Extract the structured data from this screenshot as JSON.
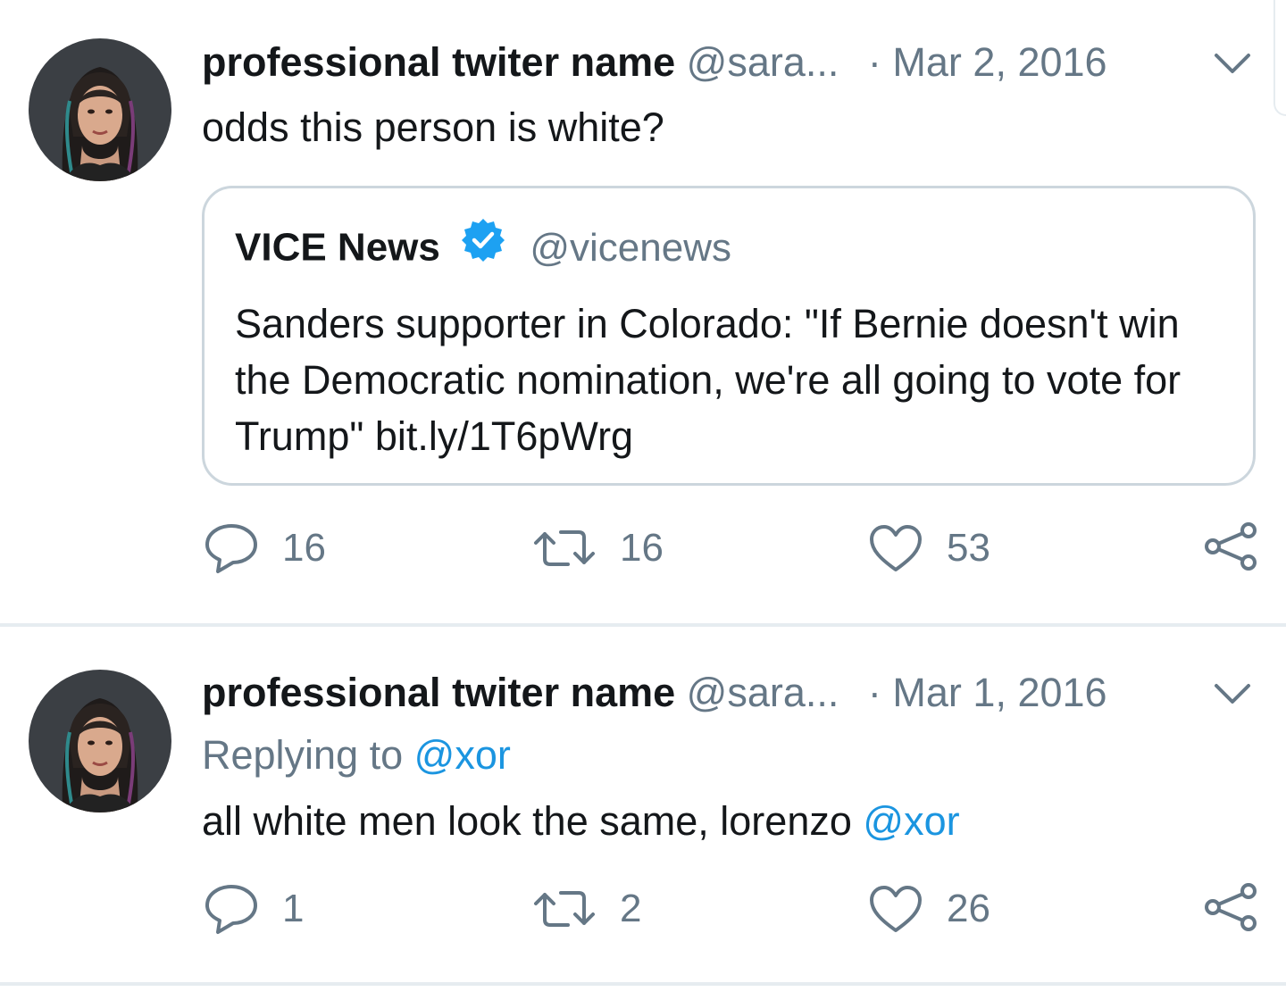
{
  "tweets": [
    {
      "author_name": "professional twiter name",
      "author_handle": "@sara...",
      "separator": "·",
      "date": "Mar 2, 2016",
      "text": "odds this person is white?",
      "quoted": {
        "name": "VICE News",
        "verified": true,
        "handle": "@vicenews",
        "text": "Sanders supporter in Colorado: \"If Bernie doesn't win the Democratic nomination, we're all going to vote for Trump\" bit.ly/1T6pWrg"
      },
      "actions": {
        "replies": "16",
        "retweets": "16",
        "likes": "53"
      }
    },
    {
      "author_name": "professional twiter name",
      "author_handle": "@sara...",
      "separator": "·",
      "date": "Mar 1, 2016",
      "replying_to_label": "Replying to",
      "replying_to_handle": "@xor",
      "text": "all white men look the same, lorenzo",
      "mention": "@xor",
      "actions": {
        "replies": "1",
        "retweets": "2",
        "likes": "26"
      }
    }
  ],
  "icons": {
    "reply": "speech-bubble-icon",
    "retweet": "retweet-arrows-icon",
    "like": "heart-icon",
    "share": "share-nodes-icon",
    "menu": "chevron-down-icon",
    "verified": "verified-badge-icon"
  },
  "colors": {
    "link": "#1b95e0",
    "secondary_text": "#657786",
    "border": "#ccd6dd",
    "divider": "#e6ecf0",
    "verified": "#1da1f2"
  }
}
